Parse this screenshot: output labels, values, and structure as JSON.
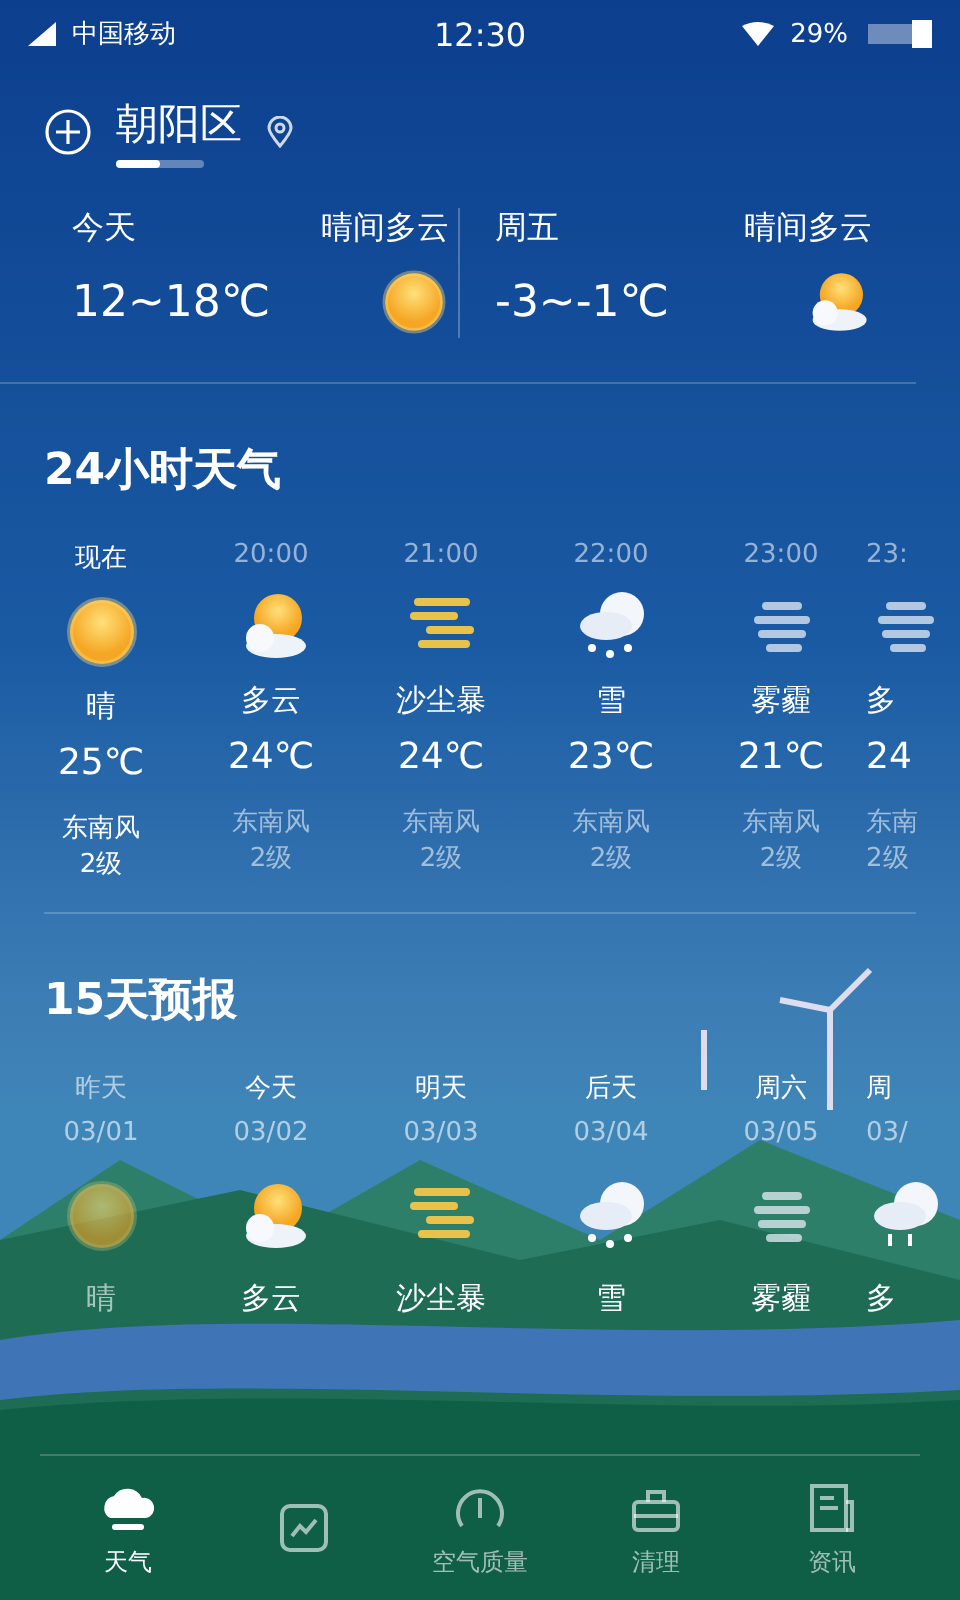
{
  "status_bar": {
    "carrier": "中国移动",
    "time": "12:30",
    "battery": "29%"
  },
  "location": {
    "name": "朝阳区"
  },
  "summary": [
    {
      "day": "今天",
      "condition": "晴间多云",
      "temp": "12~18℃",
      "kind": "sunny"
    },
    {
      "day": "周五",
      "condition": "晴间多云",
      "temp": "-3~-1℃",
      "kind": "cloudy"
    }
  ],
  "hourly": {
    "title": "24小时天气",
    "items": [
      {
        "time": "现在",
        "kind": "sunny",
        "condition": "晴",
        "temp": "25℃",
        "wind": "东南风",
        "level_text": "2级",
        "current": true
      },
      {
        "time": "20:00",
        "kind": "cloudy",
        "condition": "多云",
        "temp": "24℃",
        "wind": "东南风",
        "level_text": "2级",
        "current": false
      },
      {
        "time": "21:00",
        "kind": "sandstorm",
        "condition": "沙尘暴",
        "temp": "24℃",
        "wind": "东南风",
        "level_text": "2级",
        "current": false
      },
      {
        "time": "22:00",
        "kind": "snow",
        "condition": "雪",
        "temp": "23℃",
        "wind": "东南风",
        "level_text": "2级",
        "current": false
      },
      {
        "time": "23:00",
        "kind": "haze",
        "condition": "雾霾",
        "temp": "21℃",
        "wind": "东南风",
        "level_text": "2级",
        "current": false
      },
      {
        "time": "23:",
        "kind": "haze",
        "condition": "多",
        "temp": "24",
        "wind": "东南",
        "level_text": "2级",
        "current": false
      }
    ]
  },
  "daily": {
    "title": "15天预报",
    "items": [
      {
        "day": "昨天",
        "date": "03/01",
        "kind": "sunny",
        "condition": "晴",
        "past": true
      },
      {
        "day": "今天",
        "date": "03/02",
        "kind": "cloudy",
        "condition": "多云",
        "past": false
      },
      {
        "day": "明天",
        "date": "03/03",
        "kind": "sandstorm",
        "condition": "沙尘暴",
        "past": false
      },
      {
        "day": "后天",
        "date": "03/04",
        "kind": "snow",
        "condition": "雪",
        "past": false
      },
      {
        "day": "周六",
        "date": "03/05",
        "kind": "haze",
        "condition": "雾霾",
        "past": false
      },
      {
        "day": "周",
        "date": "03/",
        "kind": "rain",
        "condition": "多",
        "past": false
      }
    ]
  },
  "nav": [
    {
      "kind": "cloud",
      "label": "天气",
      "selected": true
    },
    {
      "kind": "chart",
      "selected": false
    },
    {
      "kind": "gauge",
      "label": "空气质量",
      "selected": false
    },
    {
      "kind": "bag",
      "label": "清理",
      "selected": false
    },
    {
      "kind": "news",
      "label": "资讯",
      "selected": false
    }
  ]
}
